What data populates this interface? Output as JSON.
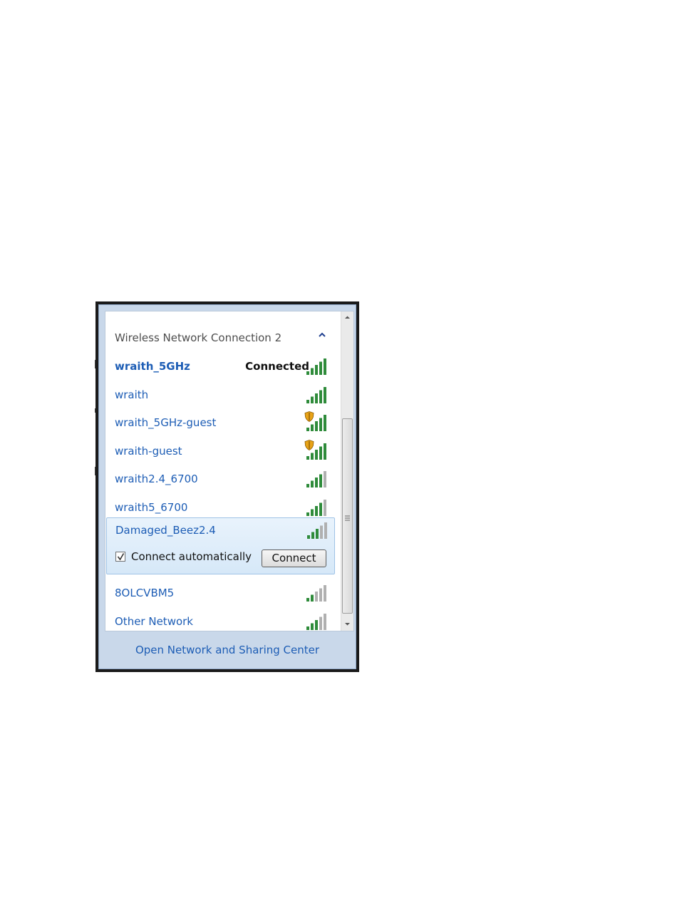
{
  "section": {
    "title": "Wireless Network Connection 2"
  },
  "networks": [
    {
      "name": "wraith_5GHz",
      "status": "Connected",
      "bold": true,
      "secured": false,
      "bars": 5
    },
    {
      "name": "wraith",
      "status": "",
      "bold": false,
      "secured": false,
      "bars": 5
    },
    {
      "name": "wraith_5GHz-guest",
      "status": "",
      "bold": false,
      "secured": true,
      "bars": 5
    },
    {
      "name": "wraith-guest",
      "status": "",
      "bold": false,
      "secured": true,
      "bars": 5
    },
    {
      "name": "wraith2.4_6700",
      "status": "",
      "bold": false,
      "secured": false,
      "bars": 4
    },
    {
      "name": "wraith5_6700",
      "status": "",
      "bold": false,
      "secured": false,
      "bars": 4
    }
  ],
  "selected": {
    "name": "Damaged_Beez2.4",
    "bars": 3,
    "connect_auto_label": "Connect automatically",
    "connect_auto_checked": true,
    "connect_label": "Connect"
  },
  "networks_after": [
    {
      "name": "8OLCVBM5",
      "bars": 2
    },
    {
      "name": "Other Network",
      "bars": 3
    }
  ],
  "footer": {
    "link": "Open Network and Sharing Center"
  },
  "colors": {
    "link": "#1d5db5",
    "bar_on": "#2e8b3a",
    "bar_off": "#b0b0b0"
  }
}
